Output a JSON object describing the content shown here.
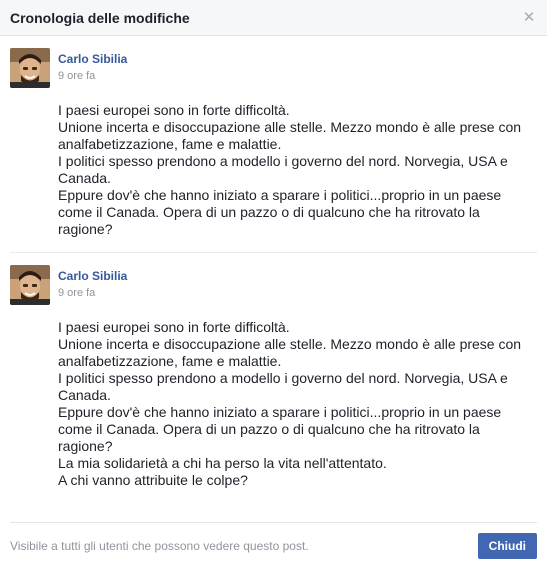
{
  "dialog": {
    "title": "Cronologia delle modifiche",
    "close_icon_glyph": "✕"
  },
  "revisions": [
    {
      "author": "Carlo Sibilia",
      "time": "9 ore fa",
      "lines": [
        "I paesi europei sono in forte difficoltà.",
        "Unione incerta e disoccupazione alle stelle. Mezzo mondo è alle prese con analfabetizzazione, fame e malattie.",
        "I politici spesso prendono a modello i governo del nord. Norvegia, USA e Canada.",
        "Eppure dov'è che hanno iniziato a sparare i politici...proprio in un paese come il Canada. Opera di un pazzo o di qualcuno che ha ritrovato la ragione?"
      ]
    },
    {
      "author": "Carlo Sibilia",
      "time": "9 ore fa",
      "lines": [
        "I paesi europei sono in forte difficoltà.",
        "Unione incerta e disoccupazione alle stelle. Mezzo mondo è alle prese con analfabetizzazione, fame e malattie.",
        "I politici spesso prendono a modello i governo del nord. Norvegia, USA e Canada.",
        "Eppure dov'è che hanno iniziato a sparare i politici...proprio in un paese come il Canada. Opera di un pazzo o di qualcuno che ha ritrovato la ragione?",
        "La mia solidarietà a chi ha perso la vita nell'attentato.",
        "A chi vanno attribuite le colpe?"
      ]
    }
  ],
  "footer": {
    "note": "Visibile a tutti gli utenti che possono vedere questo post.",
    "close_label": "Chiudi"
  },
  "colors": {
    "link": "#365899",
    "button": "#4267b2",
    "muted": "#90949c"
  }
}
